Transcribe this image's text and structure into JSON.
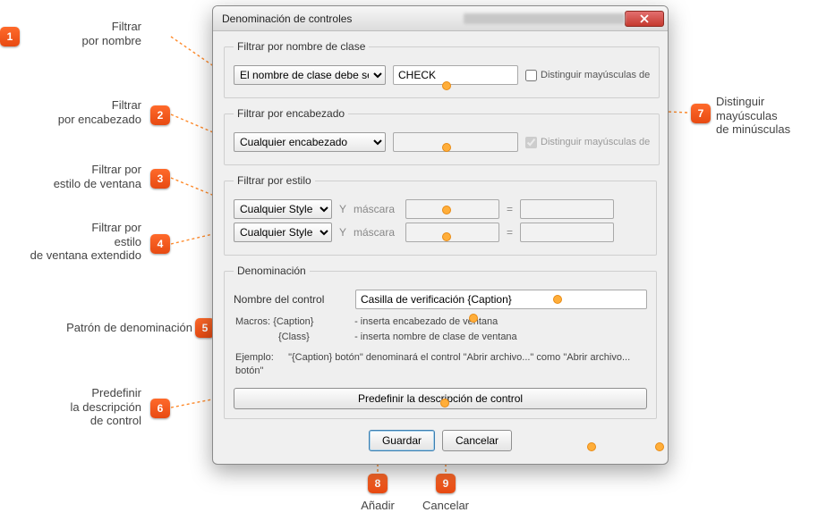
{
  "window": {
    "title": "Denominación de controles"
  },
  "sections": {
    "classname": {
      "legend": "Filtrar por nombre de clase",
      "selectValue": "El nombre de clase debe ser",
      "textValue": "CHECK",
      "caseLabel": "Distinguir mayúsculas de"
    },
    "header": {
      "legend": "Filtrar por encabezado",
      "selectValue": "Cualquier encabezado",
      "textValue": "",
      "caseLabel": "Distinguir mayúsculas de"
    },
    "style": {
      "legend": "Filtrar por estilo",
      "selectValue1": "Cualquier Style",
      "selectValue2": "Cualquier Style",
      "yLabel": "Y",
      "maskLabel": "máscara",
      "equals": "="
    },
    "denom": {
      "legend": "Denominación",
      "nameLabel": "Nombre del control",
      "nameValue": "Casilla de verificación {Caption}",
      "macrosLabel": "Macros:",
      "macroCaption": "{Caption}",
      "macroCaptionDesc": "- inserta encabezado de ventana",
      "macroClass": "{Class}",
      "macroClassDesc": "- inserta nombre de clase de ventana",
      "exampleLabel": "Ejemplo:",
      "exampleText": "\"{Caption} botón\" denominará el control \"Abrir archivo...\" como \"Abrir archivo... botón\"",
      "predefineBtn": "Predefinir la descripción de control"
    }
  },
  "buttons": {
    "save": "Guardar",
    "cancel": "Cancelar"
  },
  "annotations": {
    "a1": "Filtrar\npor nombre",
    "a2": "Filtrar\npor encabezado",
    "a3": "Filtrar por\nestilo de ventana",
    "a4": "Filtrar por\nestilo\nde ventana extendido",
    "a5": "Patrón de denominación",
    "a6": "Predefinir\nla descripción\nde control",
    "a7": "Distinguir\nmayúsculas\nde minúsculas",
    "a8": "Añadir",
    "a9": "Cancelar"
  }
}
